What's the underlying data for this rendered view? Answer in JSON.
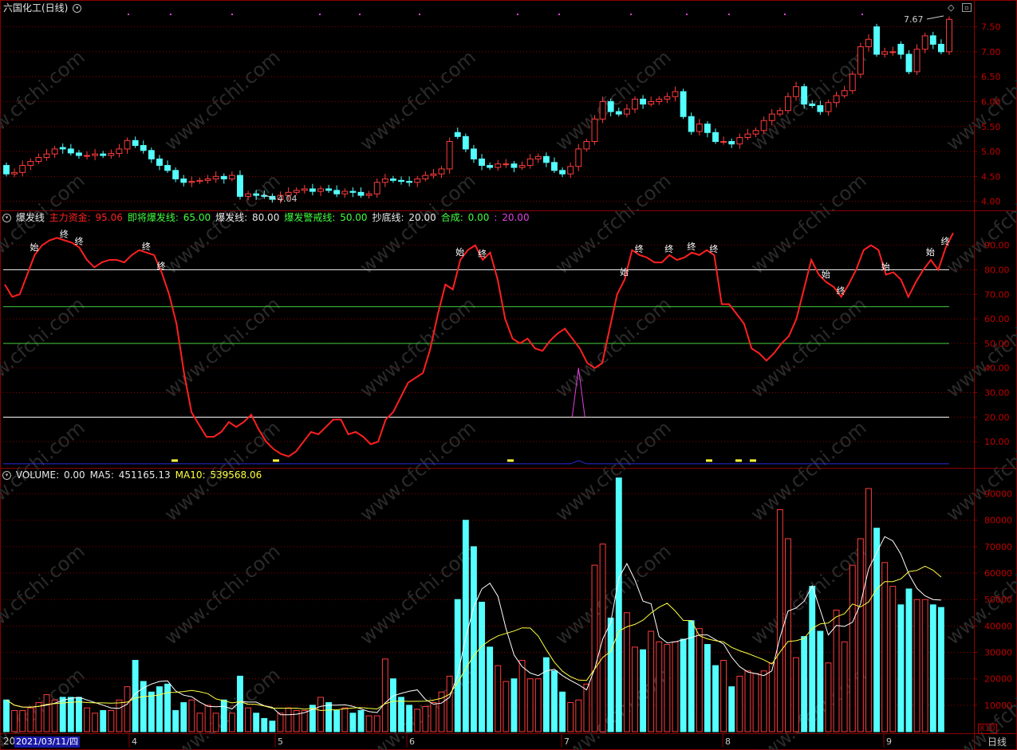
{
  "title": "六国化工(日线)",
  "price_panel": {
    "ticks": [
      "7.50",
      "7.00",
      "6.50",
      "6.00",
      "5.50",
      "5.00",
      "4.50",
      "4.00"
    ],
    "high_label": "7.67",
    "low_label": "4.04"
  },
  "indicator_panel": {
    "name": "爆发线",
    "items": [
      {
        "label": "主力资金:",
        "value": "95.06",
        "color": "#ff2020"
      },
      {
        "label": "即将爆发线:",
        "value": "65.00",
        "color": "#40ff40"
      },
      {
        "label": "爆发线:",
        "value": "80.00",
        "color": "#e8e8e8"
      },
      {
        "label": "爆发警戒线:",
        "value": "50.00",
        "color": "#40ff40"
      },
      {
        "label": "抄底线:",
        "value": "20.00",
        "color": "#e8e8e8"
      },
      {
        "label": "合成:",
        "value": "0.00",
        "color": "#40ff40"
      },
      {
        "label": ":",
        "value": "20.00",
        "color": "#e040e0"
      }
    ],
    "ticks": [
      "90.00",
      "80.00",
      "70.00",
      "60.00",
      "50.00",
      "40.00",
      "30.00",
      "20.00",
      "10.00"
    ],
    "marks": {
      "start": "始",
      "end": "终"
    }
  },
  "volume_panel": {
    "name": "VOLUME:",
    "items": [
      {
        "label": "VOLUME:",
        "value": "0.00",
        "color": "#e8e8e8"
      },
      {
        "label": "MA5:",
        "value": "451165.13",
        "color": "#e8e8e8"
      },
      {
        "label": "MA10:",
        "value": "539568.06",
        "color": "#ffff40"
      }
    ],
    "ticks": [
      "90000",
      "80000",
      "70000",
      "60000",
      "50000",
      "40000",
      "30000",
      "20000",
      "10000"
    ],
    "scale_label": "X10"
  },
  "x_axis": {
    "start_label": "20",
    "cursor_date": "2021/03/11/四",
    "months": [
      "4",
      "5",
      "6",
      "7",
      "8",
      "9"
    ],
    "period": "日线"
  },
  "watermark": "www.cfchi.com",
  "colors": {
    "up": "#ff3c3c",
    "down": "#54ffff",
    "grid": "#8b0000",
    "ma5": "#ffffff",
    "ma10": "#ffff40"
  },
  "chart_data": [
    {
      "type": "candlestick",
      "title": "六国化工(日线)",
      "ylim": [
        3.85,
        7.75
      ],
      "close": [
        4.55,
        4.58,
        4.72,
        4.8,
        4.88,
        4.95,
        5.05,
        5.05,
        4.97,
        4.92,
        4.92,
        4.95,
        4.92,
        4.96,
        5.05,
        5.22,
        5.12,
        5.02,
        4.85,
        4.72,
        4.62,
        4.45,
        4.38,
        4.4,
        4.42,
        4.45,
        4.5,
        4.45,
        4.52,
        4.1,
        4.15,
        4.12,
        4.1,
        4.04,
        4.12,
        4.18,
        4.22,
        4.25,
        4.2,
        4.25,
        4.22,
        4.15,
        4.2,
        4.18,
        4.12,
        4.15,
        4.38,
        4.45,
        4.42,
        4.4,
        4.38,
        4.45,
        4.52,
        4.55,
        4.65,
        5.2,
        5.3,
        5.05,
        4.85,
        4.72,
        4.68,
        4.75,
        4.75,
        4.68,
        4.72,
        4.85,
        4.9,
        4.78,
        4.62,
        4.55,
        4.7,
        5.05,
        5.2,
        5.65,
        6.0,
        5.8,
        5.75,
        5.85,
        6.05,
        5.95,
        6.0,
        6.05,
        6.1,
        6.2,
        5.7,
        5.4,
        5.55,
        5.38,
        5.2,
        5.2,
        5.15,
        5.28,
        5.35,
        5.42,
        5.62,
        5.75,
        5.82,
        6.1,
        6.3,
        5.95,
        5.92,
        5.8,
        5.98,
        6.12,
        6.22,
        6.55,
        7.1,
        7.25,
        6.95,
        7.0,
        7.0,
        6.95,
        6.6,
        7.05,
        7.32,
        7.15,
        7.0,
        7.65
      ],
      "open": [
        4.72,
        4.55,
        4.58,
        4.72,
        4.8,
        4.88,
        4.95,
        5.08,
        5.05,
        4.97,
        4.92,
        4.92,
        4.95,
        4.92,
        4.96,
        5.05,
        5.22,
        5.12,
        5.02,
        4.85,
        4.72,
        4.62,
        4.45,
        4.38,
        4.4,
        4.42,
        4.45,
        4.5,
        4.45,
        4.52,
        4.1,
        4.15,
        4.12,
        4.1,
        4.04,
        4.12,
        4.18,
        4.22,
        4.25,
        4.2,
        4.25,
        4.22,
        4.15,
        4.2,
        4.18,
        4.12,
        4.15,
        4.38,
        4.45,
        4.42,
        4.4,
        4.38,
        4.45,
        4.52,
        4.55,
        4.65,
        5.38,
        5.3,
        5.05,
        4.85,
        4.72,
        4.68,
        4.75,
        4.75,
        4.68,
        4.72,
        4.85,
        4.9,
        4.78,
        4.62,
        4.55,
        4.7,
        5.05,
        5.2,
        5.65,
        6.0,
        5.8,
        5.75,
        5.85,
        6.05,
        5.95,
        6.0,
        6.05,
        6.1,
        6.2,
        5.7,
        5.4,
        5.55,
        5.38,
        5.2,
        5.2,
        5.15,
        5.28,
        5.35,
        5.42,
        5.62,
        5.75,
        5.82,
        6.1,
        6.3,
        5.95,
        5.92,
        5.8,
        5.98,
        6.12,
        6.22,
        6.55,
        7.1,
        7.5,
        6.95,
        7.0,
        7.15,
        6.95,
        6.6,
        7.05,
        7.32,
        7.15,
        7.0
      ]
    },
    {
      "type": "line",
      "title": "爆发线",
      "ylim": [
        0,
        98
      ],
      "series": [
        {
          "name": "主力资金",
          "values": [
            74,
            69,
            70,
            78,
            86,
            90,
            92,
            93,
            92,
            91,
            89,
            84,
            81,
            83,
            84,
            84,
            83,
            86,
            88,
            87,
            86,
            79,
            70,
            58,
            38,
            22,
            17,
            12,
            12,
            14,
            18,
            16,
            18,
            21,
            15,
            10,
            7,
            5,
            4,
            6,
            10,
            14,
            13,
            16,
            19,
            19,
            13,
            14,
            12,
            9,
            10,
            19,
            22,
            28,
            34,
            36,
            38,
            48,
            62,
            74,
            72,
            84,
            88,
            90,
            84,
            87,
            76,
            60,
            52,
            50,
            52,
            48,
            47,
            51,
            54,
            56,
            52,
            48,
            42,
            40,
            42,
            56,
            70,
            76,
            88,
            86,
            85,
            83,
            83,
            86,
            84,
            85,
            87,
            86,
            88,
            86,
            66,
            66,
            62,
            58,
            48,
            46,
            43,
            46,
            50,
            53,
            60,
            72,
            84,
            78,
            75,
            73,
            69,
            74,
            80,
            88,
            90,
            88,
            78,
            79,
            76,
            69,
            75,
            80,
            84,
            80,
            89,
            95
          ]
        },
        {
          "name": "爆发线",
          "values": [
            80
          ]
        },
        {
          "name": "即将爆发线",
          "values": [
            65
          ]
        },
        {
          "name": "爆发警戒线",
          "values": [
            50
          ]
        },
        {
          "name": "抄底线",
          "values": [
            20
          ]
        }
      ]
    },
    {
      "type": "bar",
      "title": "VOLUME",
      "ylim": [
        0,
        95000
      ],
      "values": [
        12000,
        8000,
        8000,
        9000,
        11000,
        14000,
        12000,
        13000,
        13000,
        13000,
        9000,
        7000,
        8000,
        8000,
        12000,
        17000,
        27000,
        19000,
        15000,
        17000,
        18000,
        8000,
        11000,
        12000,
        7000,
        10000,
        7000,
        12000,
        7000,
        21000,
        9000,
        7000,
        5000,
        4000,
        7000,
        9000,
        8000,
        8000,
        10000,
        13000,
        11000,
        8000,
        9000,
        7000,
        8000,
        6000,
        6000,
        27500,
        20000,
        13000,
        10000,
        8500,
        9500,
        11000,
        15000,
        21000,
        50000,
        80000,
        70000,
        49000,
        32000,
        25000,
        19000,
        20000,
        27000,
        20000,
        20000,
        28000,
        23000,
        15000,
        11000,
        12000,
        18000,
        63000,
        71000,
        43000,
        96000,
        45000,
        32000,
        31000,
        38000,
        34000,
        33000,
        34000,
        35000,
        42000,
        39000,
        33000,
        25000,
        27000,
        17000,
        21000,
        23000,
        22000,
        23000,
        26000,
        84000,
        73000,
        28000,
        36000,
        55000,
        38000,
        26000,
        46000,
        34000,
        63000,
        73000,
        92000,
        77000,
        64000,
        55000,
        48000,
        54000,
        50000,
        50000,
        48000,
        47000
      ]
    }
  ]
}
